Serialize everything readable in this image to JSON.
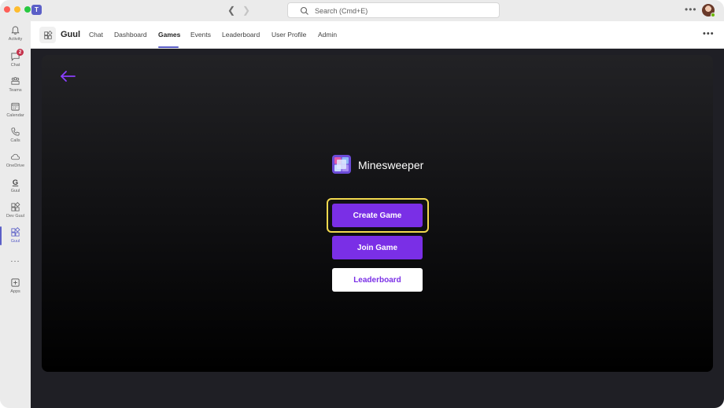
{
  "titlebar": {
    "search_placeholder": "Search (Cmd+E)",
    "app_logo_letter": "T"
  },
  "rail": {
    "items": [
      {
        "label": "Activity",
        "icon": "bell-icon"
      },
      {
        "label": "Chat",
        "icon": "chat-icon",
        "badge": "2"
      },
      {
        "label": "Teams",
        "icon": "teams-icon"
      },
      {
        "label": "Calendar",
        "icon": "calendar-icon"
      },
      {
        "label": "Calls",
        "icon": "phone-icon"
      },
      {
        "label": "OneDrive",
        "icon": "cloud-icon"
      },
      {
        "label": "Guul",
        "icon": "guul-g-icon"
      },
      {
        "label": "Dev Guul",
        "icon": "apps-grid-icon"
      },
      {
        "label": "Guul",
        "icon": "apps-grid-icon",
        "active": true
      },
      {
        "label": "Apps",
        "icon": "add-app-icon"
      }
    ],
    "more": "..."
  },
  "header": {
    "app_name": "Guul",
    "tabs": [
      {
        "label": "Chat"
      },
      {
        "label": "Dashboard"
      },
      {
        "label": "Games",
        "active": true
      },
      {
        "label": "Events"
      },
      {
        "label": "Leaderboard"
      },
      {
        "label": "User Profile"
      },
      {
        "label": "Admin"
      }
    ]
  },
  "game": {
    "title": "Minesweeper",
    "buttons": {
      "create": "Create Game",
      "join": "Join Game",
      "leaderboard": "Leaderboard"
    },
    "highlighted_button": "create"
  },
  "colors": {
    "accent": "#5b5fc7",
    "button_purple": "#7a2fe6",
    "highlight": "#f2d94e",
    "badge": "#c4314b"
  }
}
